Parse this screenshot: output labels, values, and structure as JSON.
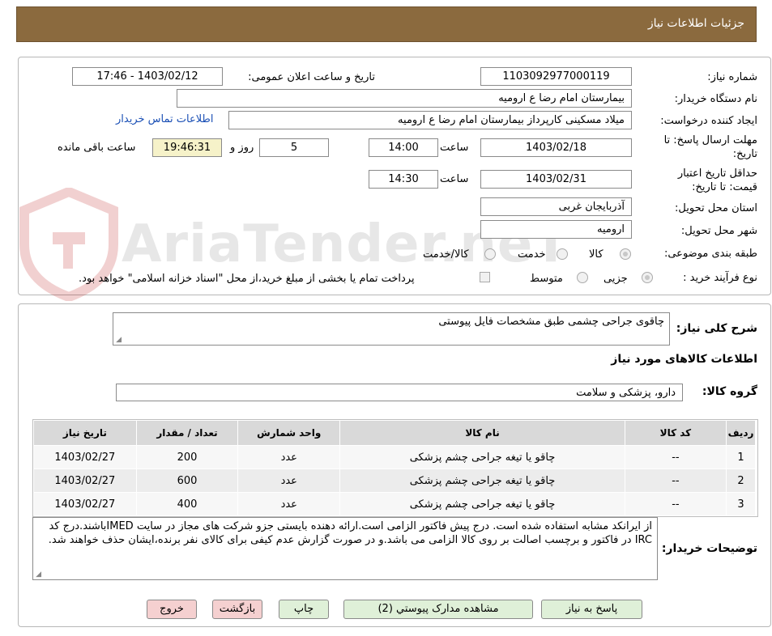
{
  "header": {
    "title": "جزئیات اطلاعات نیاز"
  },
  "form": {
    "need_number_label": "شماره نیاز:",
    "need_number": "1103092977000119",
    "announce_label": "تاریخ و ساعت اعلان عمومی:",
    "announce_value": "1403/02/12 - 17:46",
    "buyer_org_label": "نام دستگاه خریدار:",
    "buyer_org": "بیمارستان امام رضا  ع  ارومیه",
    "requester_label": "ایجاد کننده درخواست:",
    "requester": "میلاد مسکینی کارپرداز بیمارستان امام رضا  ع  ارومیه",
    "contact_link": "اطلاعات تماس خریدار",
    "deadline_label_1": "مهلت ارسال پاسخ: تا",
    "deadline_label_2": "تاریخ:",
    "deadline_date": "1403/02/18",
    "time_label": "ساعت",
    "deadline_time": "14:00",
    "days_value": "5",
    "days_label": "روز و",
    "remaining_time": "19:46:31",
    "remaining_label": "ساعت باقی مانده",
    "validity_label_1": "حداقل تاریخ اعتبار",
    "validity_label_2": "قیمت: تا تاریخ:",
    "validity_date": "1403/02/31",
    "validity_time_label": "ساعت",
    "validity_time": "14:30",
    "province_label": "استان محل تحویل:",
    "province": "آذربایجان غربی",
    "city_label": "شهر محل تحویل:",
    "city": "ارومیه",
    "category_label": "طبقه بندی موضوعی:",
    "category_options": [
      "کالا",
      "خدمت",
      "کالا/خدمت"
    ],
    "process_label": "نوع فرآیند خرید :",
    "process_options": [
      "جزیی",
      "متوسط"
    ],
    "payment_note": "پرداخت تمام یا بخشی از مبلغ خرید،از محل \"اسناد خزانه اسلامی\" خواهد بود."
  },
  "need": {
    "summary_label": "شرح کلی نیاز:",
    "summary": "چاقوی جراحی چشمی طبق مشخصات فایل پیوستی",
    "goods_info_title": "اطلاعات کالاهای مورد نیاز",
    "group_label": "گروه کالا:",
    "group_value": "دارو، پزشکی و سلامت"
  },
  "table": {
    "headers": [
      "ردیف",
      "کد کالا",
      "نام کالا",
      "واحد شمارش",
      "تعداد / مقدار",
      "تاریخ نیاز"
    ],
    "rows": [
      [
        "1",
        "--",
        "چاقو یا تیغه جراحی چشم پزشکی",
        "عدد",
        "200",
        "1403/02/27"
      ],
      [
        "2",
        "--",
        "چاقو یا تیغه جراحی چشم پزشکی",
        "عدد",
        "600",
        "1403/02/27"
      ],
      [
        "3",
        "--",
        "چاقو یا تیغه جراحی چشم پزشکی",
        "عدد",
        "400",
        "1403/02/27"
      ]
    ]
  },
  "buyer_notes": {
    "label": "توضیحات خریدار:",
    "text": "از ایرانکد مشابه استفاده شده است. درج پیش فاکتور الزامی است.ارائه دهنده بایستی جزو شرکت های مجاز در سایت IMEDباشند.درج کد IRC در فاکتور و برچسب اصالت بر روی کالا الزامی می باشد.و در صورت گزارش عدم کیفی برای کالای نفر برنده،ایشان حذف خواهند شد."
  },
  "buttons": {
    "respond": "پاسخ به نیاز",
    "attachments": "مشاهده مدارک پیوستي (2)",
    "print": "چاپ",
    "back": "بازگشت",
    "exit": "خروج"
  },
  "watermark": {
    "text": "AriaTender.neT"
  }
}
